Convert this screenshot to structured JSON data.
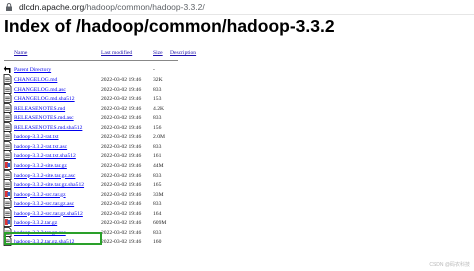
{
  "browser": {
    "url_host": "dlcdn.apache.org",
    "url_path": "/hadoop/common/hadoop-3.3.2/"
  },
  "page": {
    "title": "Index of /hadoop/common/hadoop-3.3.2"
  },
  "table": {
    "headers": {
      "name": "Name",
      "modified": "Last modified",
      "size": "Size",
      "description": "Description"
    },
    "parent": {
      "name": "Parent Directory",
      "size": "-"
    },
    "rows": [
      {
        "name": "CHANGELOG.md",
        "modified": "2022-03-02 19:46",
        "size": "32K",
        "icon": "text-file-icon"
      },
      {
        "name": "CHANGELOG.md.asc",
        "modified": "2022-03-02 19:46",
        "size": "833",
        "icon": "text-file-icon"
      },
      {
        "name": "CHANGELOG.md.sha512",
        "modified": "2022-03-02 19:46",
        "size": "153",
        "icon": "text-file-icon"
      },
      {
        "name": "RELEASENOTES.md",
        "modified": "2022-03-02 19:46",
        "size": "4.2K",
        "icon": "text-file-icon"
      },
      {
        "name": "RELEASENOTES.md.asc",
        "modified": "2022-03-02 19:46",
        "size": "833",
        "icon": "text-file-icon"
      },
      {
        "name": "RELEASENOTES.md.sha512",
        "modified": "2022-03-02 19:46",
        "size": "156",
        "icon": "text-file-icon"
      },
      {
        "name": "hadoop-3.3.2-rat.txt",
        "modified": "2022-03-02 19:46",
        "size": "2.0M",
        "icon": "text-file-icon"
      },
      {
        "name": "hadoop-3.3.2-rat.txt.asc",
        "modified": "2022-03-02 19:46",
        "size": "833",
        "icon": "text-file-icon"
      },
      {
        "name": "hadoop-3.3.2-rat.txt.sha512",
        "modified": "2022-03-02 19:46",
        "size": "161",
        "icon": "text-file-icon"
      },
      {
        "name": "hadoop-3.3.2-site.tar.gz",
        "modified": "2022-03-02 19:46",
        "size": "44M",
        "icon": "archive-file-icon"
      },
      {
        "name": "hadoop-3.3.2-site.tar.gz.asc",
        "modified": "2022-03-02 19:46",
        "size": "833",
        "icon": "text-file-icon"
      },
      {
        "name": "hadoop-3.3.2-site.tar.gz.sha512",
        "modified": "2022-03-02 19:46",
        "size": "165",
        "icon": "text-file-icon"
      },
      {
        "name": "hadoop-3.3.2-src.tar.gz",
        "modified": "2022-03-02 19:46",
        "size": "33M",
        "icon": "archive-file-icon"
      },
      {
        "name": "hadoop-3.3.2-src.tar.gz.asc",
        "modified": "2022-03-02 19:46",
        "size": "833",
        "icon": "text-file-icon"
      },
      {
        "name": "hadoop-3.3.2-src.tar.gz.sha512",
        "modified": "2022-03-02 19:46",
        "size": "164",
        "icon": "text-file-icon"
      },
      {
        "name": "hadoop-3.3.2.tar.gz",
        "modified": "2022-03-02 19:46",
        "size": "609M",
        "icon": "archive-file-icon"
      },
      {
        "name": "hadoop-3.3.2.tar.gz.asc",
        "modified": "2022-03-02 19:46",
        "size": "833",
        "icon": "text-file-icon"
      },
      {
        "name": "hadoop-3.3.2.tar.gz.sha512",
        "modified": "2022-03-02 19:46",
        "size": "160",
        "icon": "text-file-icon"
      }
    ]
  },
  "highlight": {
    "color": "#2aa02a"
  },
  "watermark": "CSDN @码农科技"
}
